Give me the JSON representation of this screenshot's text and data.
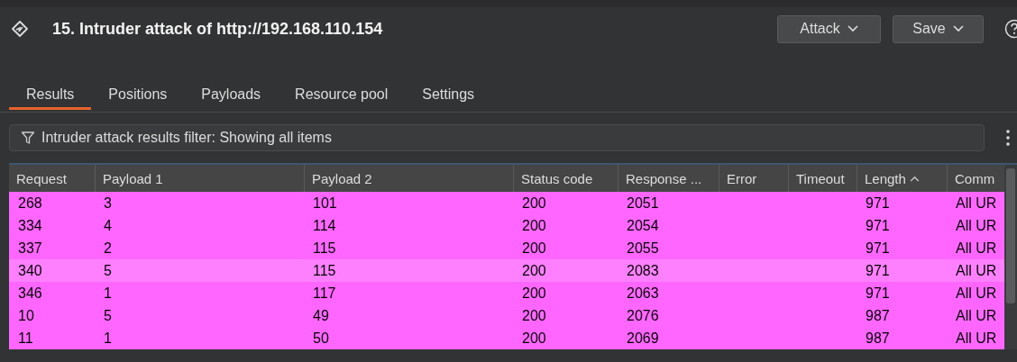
{
  "header": {
    "title": "15. Intruder attack of http://192.168.110.154",
    "buttons": [
      {
        "label": "Attack"
      },
      {
        "label": "Save"
      }
    ]
  },
  "tabs": [
    {
      "label": "Results",
      "selected": true
    },
    {
      "label": "Positions",
      "selected": false
    },
    {
      "label": "Payloads",
      "selected": false
    },
    {
      "label": "Resource pool",
      "selected": false
    },
    {
      "label": "Settings",
      "selected": false
    }
  ],
  "filter": {
    "text": "Intruder attack results filter: Showing all items"
  },
  "table": {
    "columns": [
      {
        "label": "Request",
        "sorted": false
      },
      {
        "label": "Payload 1",
        "sorted": false
      },
      {
        "label": "Payload 2",
        "sorted": false
      },
      {
        "label": "Status code",
        "sorted": false
      },
      {
        "label": "Response ...",
        "sorted": false
      },
      {
        "label": "Error",
        "sorted": false
      },
      {
        "label": "Timeout",
        "sorted": false
      },
      {
        "label": "Length",
        "sorted": true
      },
      {
        "label": "Comm",
        "sorted": false
      }
    ],
    "rows": [
      {
        "selected": false,
        "cells": [
          "268",
          "3",
          "101",
          "200",
          "2051",
          "",
          "",
          "971",
          "All UR"
        ]
      },
      {
        "selected": false,
        "cells": [
          "334",
          "4",
          "114",
          "200",
          "2054",
          "",
          "",
          "971",
          "All UR"
        ]
      },
      {
        "selected": false,
        "cells": [
          "337",
          "2",
          "115",
          "200",
          "2055",
          "",
          "",
          "971",
          "All UR"
        ]
      },
      {
        "selected": true,
        "cells": [
          "340",
          "5",
          "115",
          "200",
          "2083",
          "",
          "",
          "971",
          "All UR"
        ]
      },
      {
        "selected": false,
        "cells": [
          "346",
          "1",
          "117",
          "200",
          "2063",
          "",
          "",
          "971",
          "All UR"
        ]
      },
      {
        "selected": false,
        "cells": [
          "10",
          "5",
          "49",
          "200",
          "2076",
          "",
          "",
          "987",
          "All UR"
        ]
      },
      {
        "selected": false,
        "cells": [
          "11",
          "1",
          "50",
          "200",
          "2069",
          "",
          "",
          "987",
          "All UR"
        ]
      }
    ]
  }
}
